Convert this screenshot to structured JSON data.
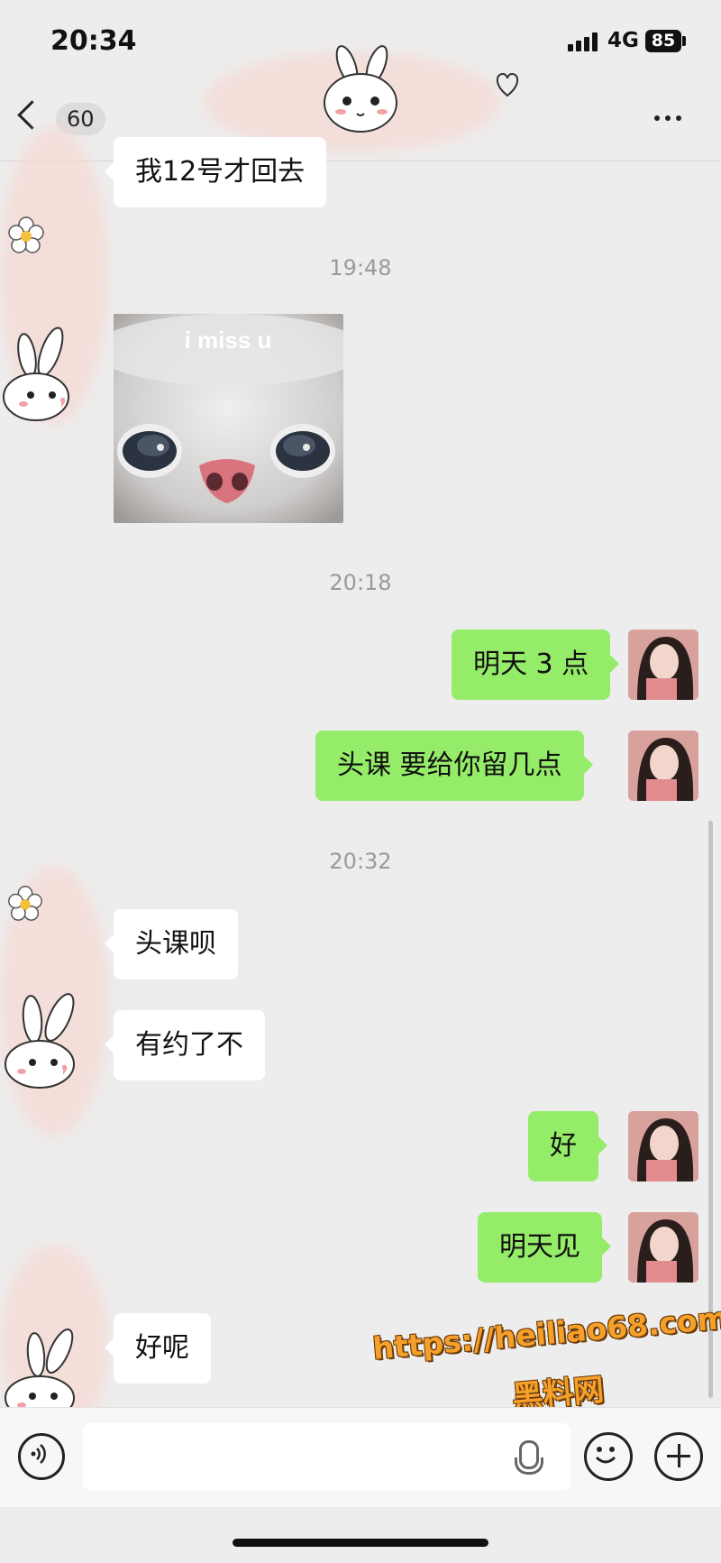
{
  "status_bar": {
    "time": "20:34",
    "network": "4G",
    "battery": "85"
  },
  "header": {
    "unread_count": "60"
  },
  "messages": {
    "m1": "我12号才回去",
    "t1": "19:48",
    "sticker_text": "i miss u",
    "t2": "20:18",
    "m2": "明天 3 点",
    "m3": "头课 要给你留几点",
    "t3": "20:32",
    "m4": "头课呗",
    "m5": "有约了不",
    "m6": "好",
    "m7": "明天见",
    "m8": "好呢"
  },
  "watermark": {
    "line1": "https://heiliao68.com",
    "line2": "黑料网"
  },
  "colors": {
    "outgoing_bubble": "#95ec69",
    "incoming_bubble": "#ffffff",
    "background": "#ededed"
  }
}
